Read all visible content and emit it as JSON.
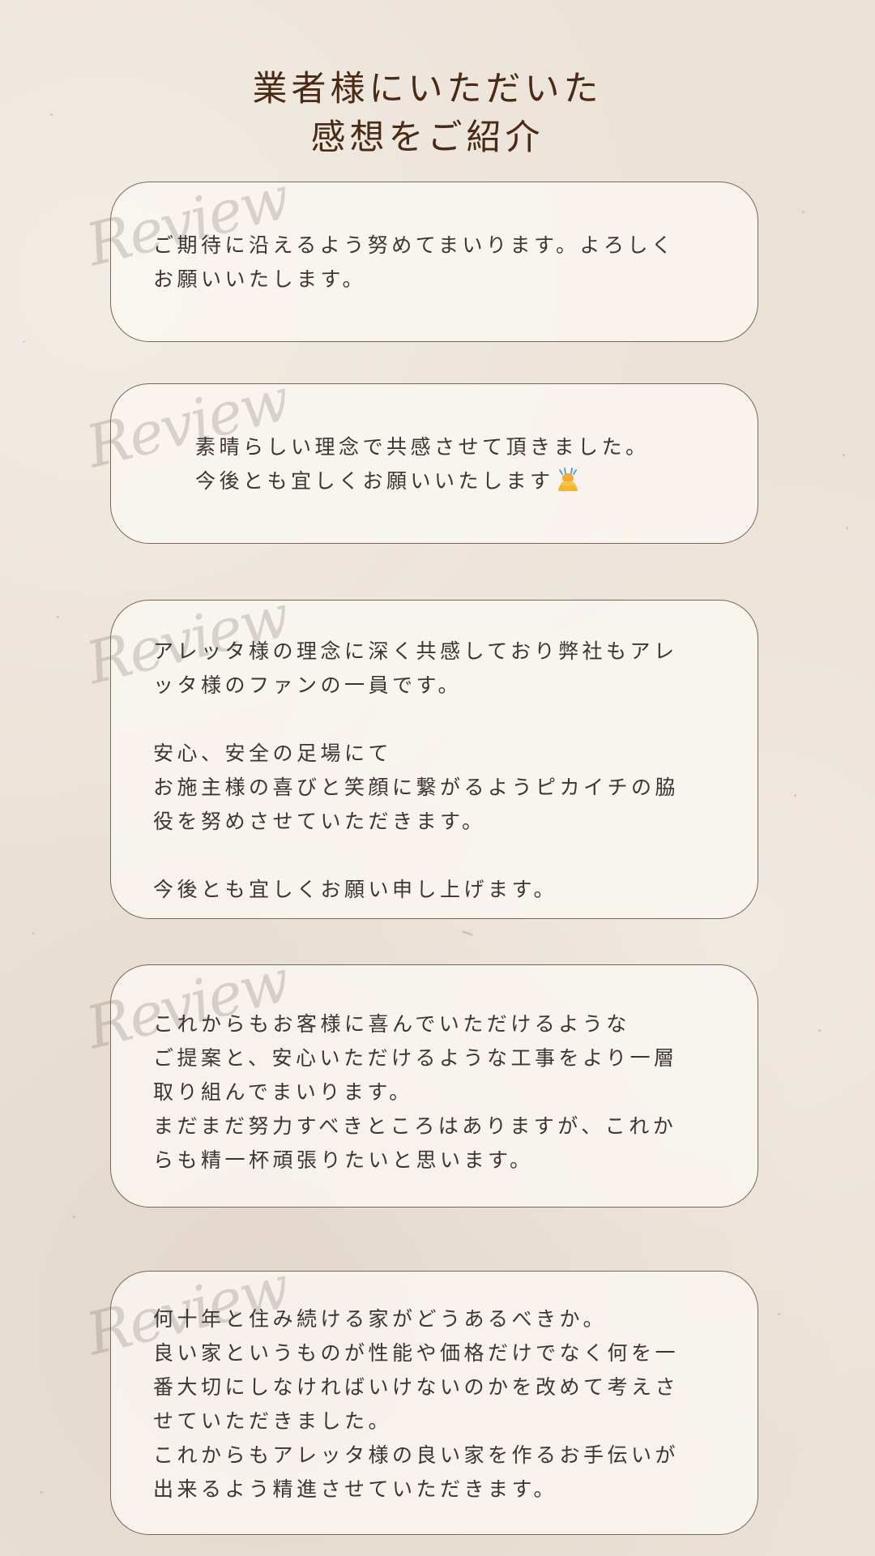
{
  "header": {
    "title_line1": "業者様にいただいた",
    "title_line2": "感想をご紹介"
  },
  "decoration": {
    "script_word": "Review"
  },
  "reviews": [
    {
      "text": "ご期待に沿えるよう努めてまいります。よろしく\nお願いいたします。"
    },
    {
      "text": "素晴らしい理念で共感させて頂きました。\n今後とも宜しくお願いいたします"
    },
    {
      "text": "アレッタ様の理念に深く共感しており弊社もアレ\nッタ様のファンの一員です。\n\n安心、安全の足場にて\nお施主様の喜びと笑顔に繋がるようピカイチの脇\n役を努めさせていただきます。\n\n今後とも宜しくお願い申し上げます。"
    },
    {
      "text": "これからもお客様に喜んでいただけるような\nご提案と、安心いただけるような工事をより一層\n取り組んでまいります。\nまだまだ努力すべきところはありますが、これか\nらも精一杯頑張りたいと思います。"
    },
    {
      "text": "何十年と住み続ける家がどうあるべきか。\n良い家というものが性能や価格だけでなく何を一\n番大切にしなければいけないのかを改めて考えさ\nせていただきました。\nこれからもアレッタ様の良い家を作るお手伝いが\n出来るよう精進させていただきます。"
    }
  ],
  "icons": {
    "bowing_person": "bowing-person-emoji"
  }
}
